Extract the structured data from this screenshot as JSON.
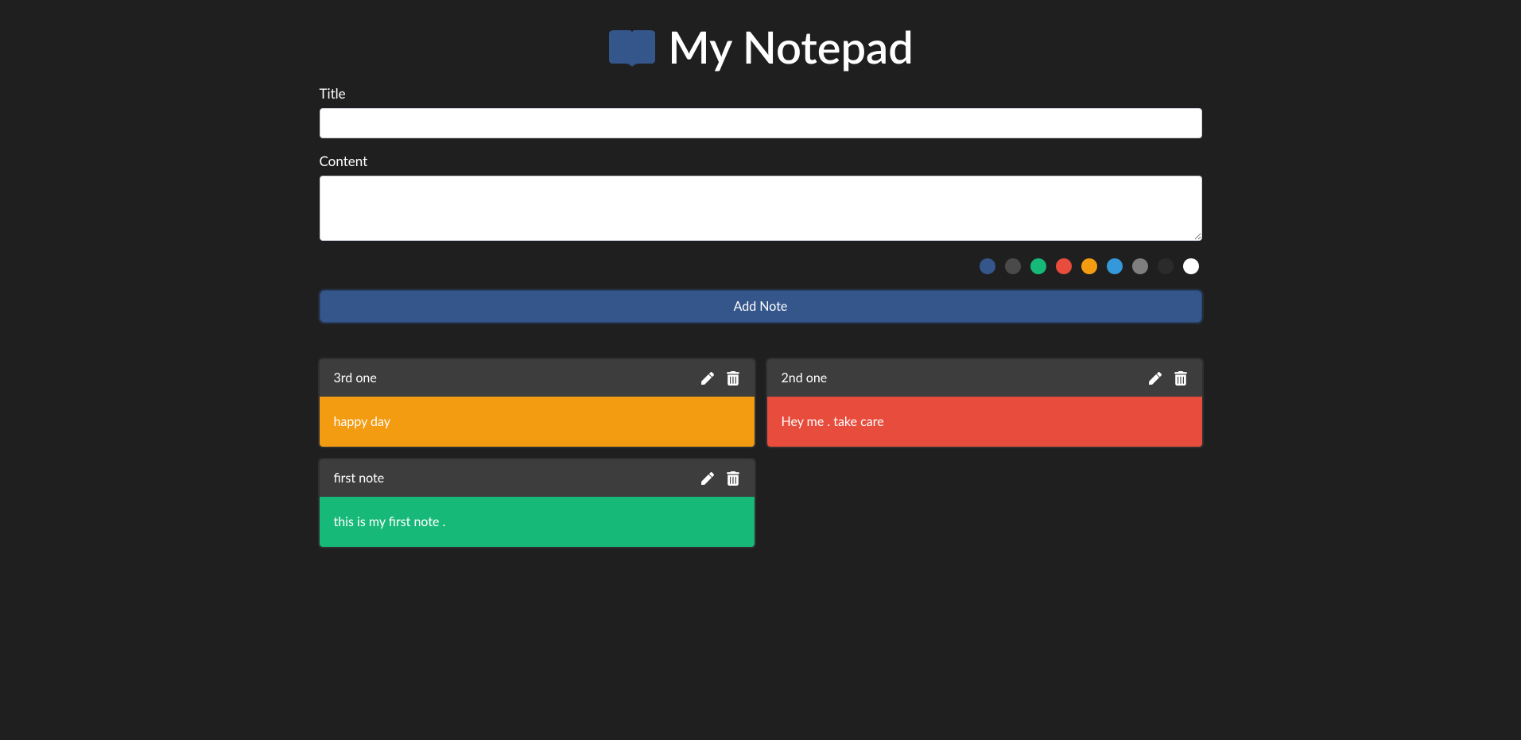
{
  "header": {
    "title": "My Notepad"
  },
  "form": {
    "title_label": "Title",
    "title_value": "",
    "content_label": "Content",
    "content_value": "",
    "add_button": "Add Note"
  },
  "colors": [
    {
      "name": "blue-dark",
      "hex": "#34568B"
    },
    {
      "name": "gray-dark",
      "hex": "#4a4a4a"
    },
    {
      "name": "green",
      "hex": "#17b978"
    },
    {
      "name": "red",
      "hex": "#e74c3c"
    },
    {
      "name": "orange",
      "hex": "#f39c12"
    },
    {
      "name": "blue",
      "hex": "#3498db"
    },
    {
      "name": "gray",
      "hex": "#7f7f7f"
    },
    {
      "name": "charcoal",
      "hex": "#2b2b2b"
    },
    {
      "name": "white",
      "hex": "#ffffff"
    }
  ],
  "notes": [
    {
      "title": "3rd one",
      "content": "happy day",
      "color": "#f39c12"
    },
    {
      "title": "2nd one",
      "content": "Hey me . take care",
      "color": "#e74c3c"
    },
    {
      "title": "first note",
      "content": "this is my first note .",
      "color": "#17b978"
    }
  ]
}
